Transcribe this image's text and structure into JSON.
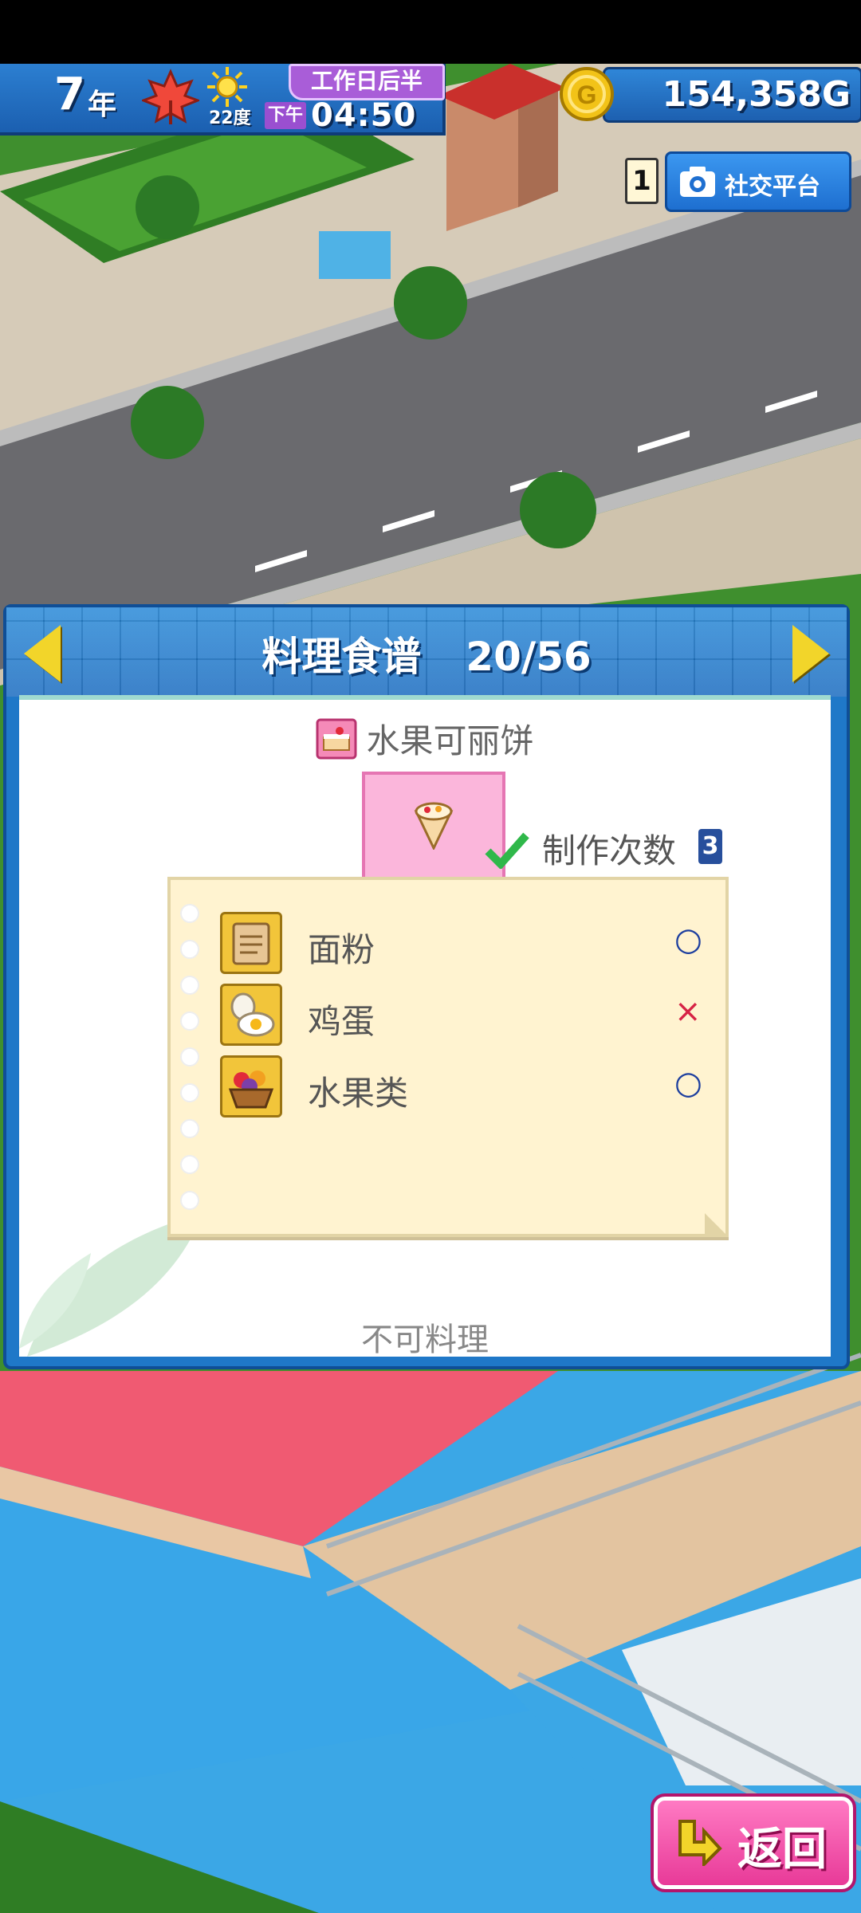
{
  "hud": {
    "year_number": "7",
    "year_unit": "年",
    "season_icon": "maple-leaf-icon",
    "weather_icon": "sun-icon",
    "temperature": "22度",
    "period": "工作日后半",
    "ampm": "下午",
    "time": "04:50",
    "coin_icon": "gold-coin-icon",
    "money": "154,358G"
  },
  "social": {
    "count": "1",
    "button_label": "社交平台",
    "icon": "camera-icon"
  },
  "recipe_panel": {
    "title": "料理食谱",
    "progress": "20/56",
    "dish_icon": "cake-icon",
    "dish_name": "水果可丽饼",
    "preview_icon": "crepe-icon",
    "made_label": "制作次数",
    "made_count": "3",
    "ingredients": [
      {
        "name": "面粉",
        "icon": "flour-bag-icon",
        "status": "○"
      },
      {
        "name": "鸡蛋",
        "icon": "egg-icon",
        "status": "×"
      },
      {
        "name": "水果类",
        "icon": "fruit-basket-icon",
        "status": "○"
      }
    ],
    "cannot_cook_text": "不可料理"
  },
  "back_button": {
    "label": "返回",
    "icon": "back-arrow-icon"
  },
  "colors": {
    "panel_blue": "#1f78c8",
    "arrow_yellow": "#f2d52a",
    "preview_pink": "#fbb6db",
    "back_pink": "#ff7ac3",
    "ok_blue": "#1d3f9f",
    "ng_red": "#d62345"
  }
}
